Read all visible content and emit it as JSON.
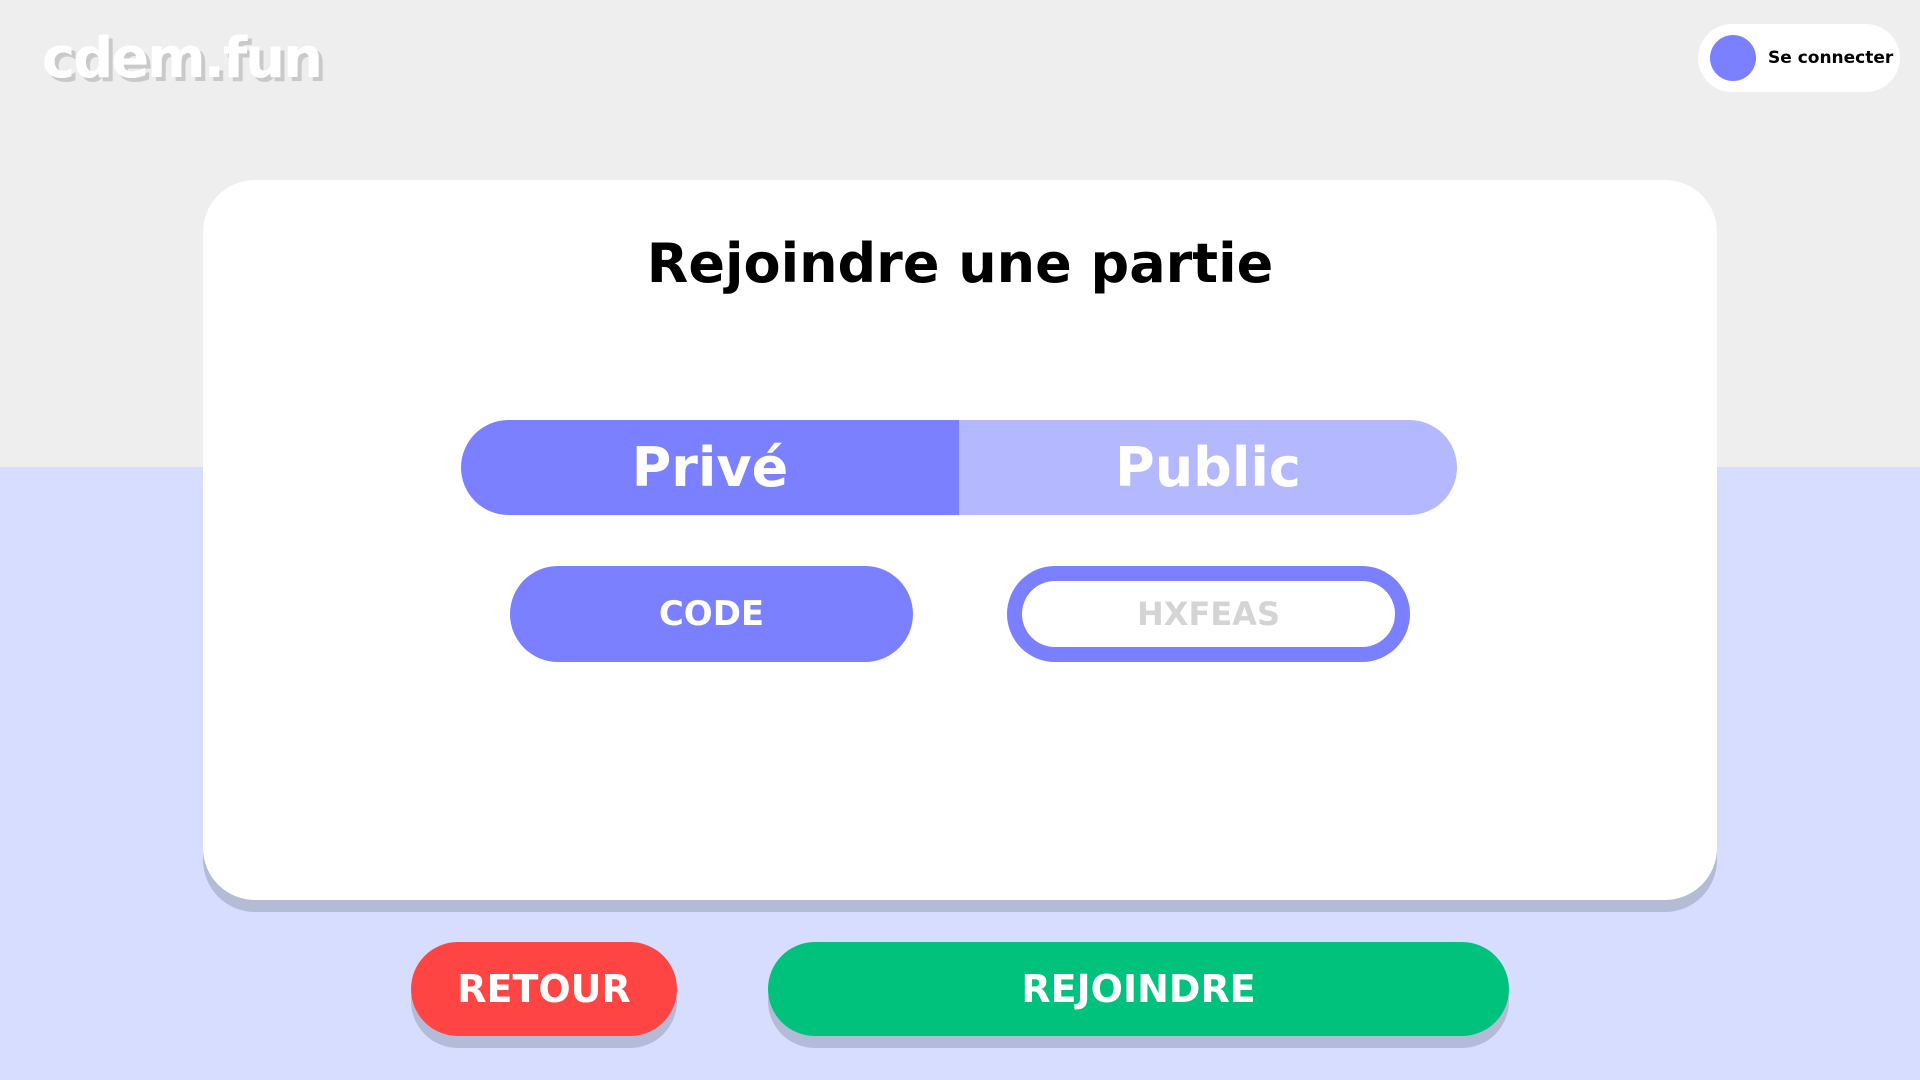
{
  "header": {
    "logo": "cdem.fun",
    "login_label": "Se connecter"
  },
  "card": {
    "title": "Rejoindre une partie",
    "toggle": {
      "private_label": "Privé",
      "public_label": "Public",
      "selected": "Privé"
    },
    "code_label": "CODE",
    "code_placeholder": "HXFEAS"
  },
  "actions": {
    "back_label": "RETOUR",
    "join_label": "REJOINDRE"
  },
  "colors": {
    "accent": "#7a80ff",
    "accent_light": "#b4b8ff",
    "danger": "#ff4444",
    "success": "#00c27c",
    "background_top": "#eeeeee",
    "background_bottom": "#d6ddfe"
  }
}
